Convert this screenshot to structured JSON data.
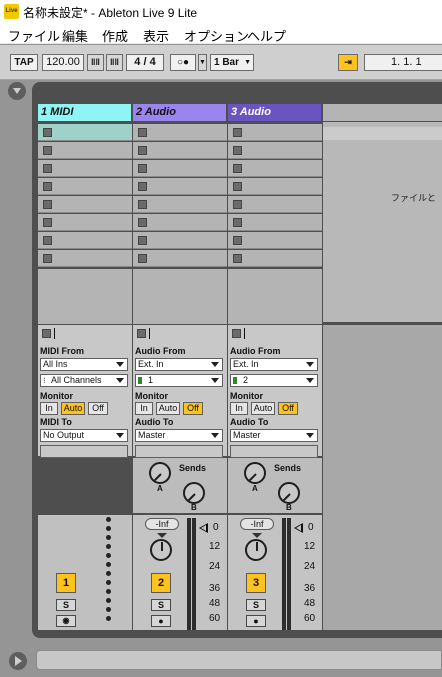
{
  "window": {
    "title": "名称未設定* - Ableton Live 9 Lite",
    "logo_text": "Live"
  },
  "menu": [
    "ファイル",
    "編集",
    "作成",
    "表示",
    "オプション",
    "ヘルプ"
  ],
  "control_bar": {
    "tap": "TAP",
    "tempo": "120.00",
    "nudge_down": "‖‖",
    "nudge_up": "‖‖",
    "time_signature": "4 / 4",
    "metronome": "○●",
    "quantize": "1 Bar",
    "follow": "⇥",
    "position": "1.   1.   1"
  },
  "tracks": [
    {
      "name": "1 MIDI",
      "header_color": "#8ef4f4",
      "number": "1",
      "in_label": "MIDI From",
      "in_source": "All Ins",
      "in_channel": "All Channels",
      "monitor_label": "Monitor",
      "monitor": [
        "In",
        "Auto",
        "Off"
      ],
      "monitor_active": "Auto",
      "out_label": "MIDI To",
      "out_target": "No Output",
      "solo": "S"
    },
    {
      "name": "2 Audio",
      "header_color": "#9a84ee",
      "number": "2",
      "in_label": "Audio From",
      "in_source": "Ext. In",
      "in_channel": "1",
      "monitor_label": "Monitor",
      "monitor": [
        "In",
        "Auto",
        "Off"
      ],
      "monitor_active": "Off",
      "out_label": "Audio To",
      "out_target": "Master",
      "sends_label": "Sends",
      "send_a": "A",
      "send_b": "B",
      "volume": "-Inf",
      "scale": [
        "0",
        "12",
        "24",
        "36",
        "48",
        "60"
      ],
      "solo": "S"
    },
    {
      "name": "3 Audio",
      "header_color": "#6a54c2",
      "number": "3",
      "in_label": "Audio From",
      "in_source": "Ext. In",
      "in_channel": "2",
      "monitor_label": "Monitor",
      "monitor": [
        "In",
        "Auto",
        "Off"
      ],
      "monitor_active": "Off",
      "out_label": "Audio To",
      "out_target": "Master",
      "sends_label": "Sends",
      "send_a": "A",
      "send_b": "B",
      "volume": "-Inf",
      "scale": [
        "0",
        "12",
        "24",
        "36",
        "48",
        "60"
      ],
      "solo": "S"
    }
  ],
  "drop_hint": "ファイルと",
  "colors": {
    "accent_yellow": "#fec21e",
    "selected_slot": "#9ed2c9"
  }
}
